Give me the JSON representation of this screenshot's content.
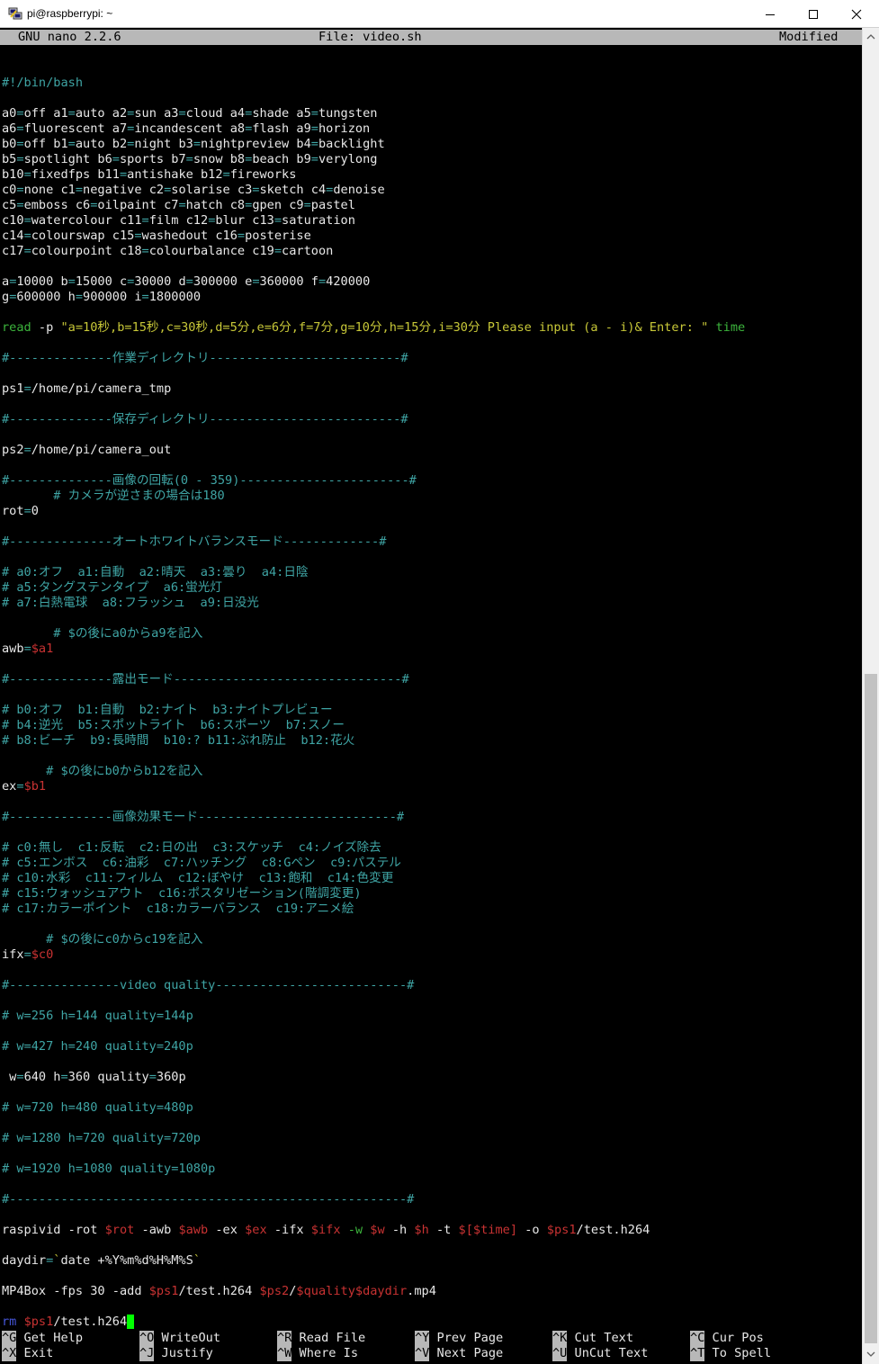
{
  "window": {
    "title": "pi@raspberrypi: ~",
    "minimize_icon": "minimize-icon",
    "maximize_icon": "maximize-icon",
    "close_icon": "close-icon"
  },
  "nano": {
    "version": "GNU nano 2.2.6",
    "file": "File: video.sh",
    "status": "Modified"
  },
  "lines": [
    [],
    [
      [
        "c",
        "#!/bin/bash"
      ]
    ],
    [],
    [
      [
        "t",
        "a0"
      ],
      [
        "c",
        "="
      ],
      [
        "t",
        "off a1"
      ],
      [
        "c",
        "="
      ],
      [
        "t",
        "auto a2"
      ],
      [
        "c",
        "="
      ],
      [
        "t",
        "sun a3"
      ],
      [
        "c",
        "="
      ],
      [
        "t",
        "cloud a4"
      ],
      [
        "c",
        "="
      ],
      [
        "t",
        "shade a5"
      ],
      [
        "c",
        "="
      ],
      [
        "t",
        "tungsten"
      ]
    ],
    [
      [
        "t",
        "a6"
      ],
      [
        "c",
        "="
      ],
      [
        "t",
        "fluorescent a7"
      ],
      [
        "c",
        "="
      ],
      [
        "t",
        "incandescent a8"
      ],
      [
        "c",
        "="
      ],
      [
        "t",
        "flash a9"
      ],
      [
        "c",
        "="
      ],
      [
        "t",
        "horizon"
      ]
    ],
    [
      [
        "t",
        "b0"
      ],
      [
        "c",
        "="
      ],
      [
        "t",
        "off b1"
      ],
      [
        "c",
        "="
      ],
      [
        "t",
        "auto b2"
      ],
      [
        "c",
        "="
      ],
      [
        "t",
        "night b3"
      ],
      [
        "c",
        "="
      ],
      [
        "t",
        "nightpreview b4"
      ],
      [
        "c",
        "="
      ],
      [
        "t",
        "backlight"
      ]
    ],
    [
      [
        "t",
        "b5"
      ],
      [
        "c",
        "="
      ],
      [
        "t",
        "spotlight b6"
      ],
      [
        "c",
        "="
      ],
      [
        "t",
        "sports b7"
      ],
      [
        "c",
        "="
      ],
      [
        "t",
        "snow b8"
      ],
      [
        "c",
        "="
      ],
      [
        "t",
        "beach b9"
      ],
      [
        "c",
        "="
      ],
      [
        "t",
        "verylong"
      ]
    ],
    [
      [
        "t",
        "b10"
      ],
      [
        "c",
        "="
      ],
      [
        "t",
        "fixedfps b11"
      ],
      [
        "c",
        "="
      ],
      [
        "t",
        "antishake b12"
      ],
      [
        "c",
        "="
      ],
      [
        "t",
        "fireworks"
      ]
    ],
    [
      [
        "t",
        "c0"
      ],
      [
        "c",
        "="
      ],
      [
        "t",
        "none c1"
      ],
      [
        "c",
        "="
      ],
      [
        "t",
        "negative c2"
      ],
      [
        "c",
        "="
      ],
      [
        "t",
        "solarise c3"
      ],
      [
        "c",
        "="
      ],
      [
        "t",
        "sketch c4"
      ],
      [
        "c",
        "="
      ],
      [
        "t",
        "denoise"
      ]
    ],
    [
      [
        "t",
        "c5"
      ],
      [
        "c",
        "="
      ],
      [
        "t",
        "emboss c6"
      ],
      [
        "c",
        "="
      ],
      [
        "t",
        "oilpaint c7"
      ],
      [
        "c",
        "="
      ],
      [
        "t",
        "hatch c8"
      ],
      [
        "c",
        "="
      ],
      [
        "t",
        "gpen c9"
      ],
      [
        "c",
        "="
      ],
      [
        "t",
        "pastel"
      ]
    ],
    [
      [
        "t",
        "c10"
      ],
      [
        "c",
        "="
      ],
      [
        "t",
        "watercolour c11"
      ],
      [
        "c",
        "="
      ],
      [
        "t",
        "film c12"
      ],
      [
        "c",
        "="
      ],
      [
        "t",
        "blur c13"
      ],
      [
        "c",
        "="
      ],
      [
        "t",
        "saturation"
      ]
    ],
    [
      [
        "t",
        "c14"
      ],
      [
        "c",
        "="
      ],
      [
        "t",
        "colourswap c15"
      ],
      [
        "c",
        "="
      ],
      [
        "t",
        "washedout c16"
      ],
      [
        "c",
        "="
      ],
      [
        "t",
        "posterise"
      ]
    ],
    [
      [
        "t",
        "c17"
      ],
      [
        "c",
        "="
      ],
      [
        "t",
        "colourpoint c18"
      ],
      [
        "c",
        "="
      ],
      [
        "t",
        "colourbalance c19"
      ],
      [
        "c",
        "="
      ],
      [
        "t",
        "cartoon"
      ]
    ],
    [],
    [
      [
        "t",
        "a"
      ],
      [
        "c",
        "="
      ],
      [
        "t",
        "10000 b"
      ],
      [
        "c",
        "="
      ],
      [
        "t",
        "15000 c"
      ],
      [
        "c",
        "="
      ],
      [
        "t",
        "30000 d"
      ],
      [
        "c",
        "="
      ],
      [
        "t",
        "300000 e"
      ],
      [
        "c",
        "="
      ],
      [
        "t",
        "360000 f"
      ],
      [
        "c",
        "="
      ],
      [
        "t",
        "420000"
      ]
    ],
    [
      [
        "t",
        "g"
      ],
      [
        "c",
        "="
      ],
      [
        "t",
        "600000 h"
      ],
      [
        "c",
        "="
      ],
      [
        "t",
        "900000 i"
      ],
      [
        "c",
        "="
      ],
      [
        "t",
        "1800000"
      ]
    ],
    [],
    [
      [
        "g",
        "read"
      ],
      [
        "t",
        " -p "
      ],
      [
        "s",
        "\"a=10秒,b=15秒,c=30秒,d=5分,e=6分,f=7分,g=10分,h=15分,i=30分 Please input (a - i)& Enter: \""
      ],
      [
        "t",
        " "
      ],
      [
        "g",
        "time"
      ]
    ],
    [],
    [
      [
        "c",
        "#--------------作業ディレクトリ--------------------------#"
      ]
    ],
    [],
    [
      [
        "t",
        "ps1"
      ],
      [
        "c",
        "="
      ],
      [
        "t",
        "/home/pi/camera_tmp"
      ]
    ],
    [],
    [
      [
        "c",
        "#--------------保存ディレクトリ--------------------------#"
      ]
    ],
    [],
    [
      [
        "t",
        "ps2"
      ],
      [
        "c",
        "="
      ],
      [
        "t",
        "/home/pi/camera_out"
      ]
    ],
    [],
    [
      [
        "c",
        "#--------------画像の回転(0 - 359)-----------------------#"
      ]
    ],
    [
      [
        "c",
        "       # カメラが逆さまの場合は180"
      ]
    ],
    [
      [
        "t",
        "rot"
      ],
      [
        "c",
        "="
      ],
      [
        "t",
        "0"
      ]
    ],
    [],
    [
      [
        "c",
        "#--------------オートホワイトバランスモード-------------#"
      ]
    ],
    [],
    [
      [
        "c",
        "# a0:オフ  a1:自動  a2:晴天  a3:曇り  a4:日陰"
      ]
    ],
    [
      [
        "c",
        "# a5:タングステンタイプ  a6:蛍光灯"
      ]
    ],
    [
      [
        "c",
        "# a7:白熱電球  a8:フラッシュ  a9:日没光"
      ]
    ],
    [],
    [
      [
        "c",
        "       # $の後にa0からa9を記入"
      ]
    ],
    [
      [
        "t",
        "awb"
      ],
      [
        "c",
        "="
      ],
      [
        "v",
        "$a1"
      ]
    ],
    [],
    [
      [
        "c",
        "#--------------露出モード-------------------------------#"
      ]
    ],
    [],
    [
      [
        "c",
        "# b0:オフ  b1:自動  b2:ナイト  b3:ナイトプレビュー"
      ]
    ],
    [
      [
        "c",
        "# b4:逆光  b5:スポットライト  b6:スポーツ  b7:スノー"
      ]
    ],
    [
      [
        "c",
        "# b8:ビーチ  b9:長時間  b10:? b11:ぶれ防止  b12:花火"
      ]
    ],
    [],
    [
      [
        "c",
        "      # $の後にb0からb12を記入"
      ]
    ],
    [
      [
        "t",
        "ex"
      ],
      [
        "c",
        "="
      ],
      [
        "v",
        "$b1"
      ]
    ],
    [],
    [
      [
        "c",
        "#--------------画像効果モード---------------------------#"
      ]
    ],
    [],
    [
      [
        "c",
        "# c0:無し  c1:反転  c2:日の出  c3:スケッチ  c4:ノイズ除去"
      ]
    ],
    [
      [
        "c",
        "# c5:エンボス  c6:油彩  c7:ハッチング  c8:Gペン  c9:パステル"
      ]
    ],
    [
      [
        "c",
        "# c10:水彩  c11:フィルム  c12:ぼやけ  c13:飽和  c14:色変更"
      ]
    ],
    [
      [
        "c",
        "# c15:ウォッシュアウト  c16:ポスタリゼーション(階調変更)"
      ]
    ],
    [
      [
        "c",
        "# c17:カラーポイント  c18:カラーバランス  c19:アニメ絵"
      ]
    ],
    [],
    [
      [
        "c",
        "      # $の後にc0からc19を記入"
      ]
    ],
    [
      [
        "t",
        "ifx"
      ],
      [
        "c",
        "="
      ],
      [
        "v",
        "$c0"
      ]
    ],
    [],
    [
      [
        "c",
        "#---------------video quality--------------------------#"
      ]
    ],
    [],
    [
      [
        "c",
        "# w=256 h=144 quality=144p"
      ]
    ],
    [],
    [
      [
        "c",
        "# w=427 h=240 quality=240p"
      ]
    ],
    [],
    [
      [
        "t",
        " w"
      ],
      [
        "c",
        "="
      ],
      [
        "t",
        "640 h"
      ],
      [
        "c",
        "="
      ],
      [
        "t",
        "360 quality"
      ],
      [
        "c",
        "="
      ],
      [
        "t",
        "360p"
      ]
    ],
    [],
    [
      [
        "c",
        "# w=720 h=480 quality=480p"
      ]
    ],
    [],
    [
      [
        "c",
        "# w=1280 h=720 quality=720p"
      ]
    ],
    [],
    [
      [
        "c",
        "# w=1920 h=1080 quality=1080p"
      ]
    ],
    [],
    [
      [
        "c",
        "#------------------------------------------------------#"
      ]
    ],
    [],
    [
      [
        "t",
        "raspivid -rot "
      ],
      [
        "v",
        "$rot"
      ],
      [
        "t",
        " -awb "
      ],
      [
        "v",
        "$awb"
      ],
      [
        "t",
        " -ex "
      ],
      [
        "v",
        "$ex"
      ],
      [
        "t",
        " -ifx "
      ],
      [
        "v",
        "$ifx"
      ],
      [
        "t",
        " "
      ],
      [
        "g",
        "-w"
      ],
      [
        "t",
        " "
      ],
      [
        "v",
        "$w"
      ],
      [
        "t",
        " -h "
      ],
      [
        "v",
        "$h"
      ],
      [
        "t",
        " -t "
      ],
      [
        "v",
        "$[$time]"
      ],
      [
        "t",
        " -o "
      ],
      [
        "v",
        "$ps1"
      ],
      [
        "t",
        "/test.h264"
      ]
    ],
    [],
    [
      [
        "t",
        "daydir"
      ],
      [
        "c",
        "="
      ],
      [
        "s",
        "`"
      ],
      [
        "t",
        "date +%Y%m%d%H%M%S"
      ],
      [
        "s",
        "`"
      ]
    ],
    [],
    [
      [
        "t",
        "MP4Box -fps 30 -add "
      ],
      [
        "v",
        "$ps1"
      ],
      [
        "t",
        "/test.h264 "
      ],
      [
        "v",
        "$ps2"
      ],
      [
        "t",
        "/"
      ],
      [
        "v",
        "$quality$daydir"
      ],
      [
        "t",
        ".mp4"
      ]
    ],
    [],
    [
      [
        "b",
        "rm"
      ],
      [
        "t",
        " "
      ],
      [
        "v",
        "$ps1"
      ],
      [
        "t",
        "/test.h264"
      ]
    ]
  ],
  "shortcuts": [
    {
      "key": "^G",
      "label": "Get Help"
    },
    {
      "key": "^O",
      "label": "WriteOut"
    },
    {
      "key": "^R",
      "label": "Read File"
    },
    {
      "key": "^Y",
      "label": "Prev Page"
    },
    {
      "key": "^K",
      "label": "Cut Text"
    },
    {
      "key": "^C",
      "label": "Cur Pos"
    },
    {
      "key": "^X",
      "label": "Exit"
    },
    {
      "key": "^J",
      "label": "Justify"
    },
    {
      "key": "^W",
      "label": "Where Is"
    },
    {
      "key": "^V",
      "label": "Next Page"
    },
    {
      "key": "^U",
      "label": "UnCut Text"
    },
    {
      "key": "^T",
      "label": "To Spell"
    }
  ],
  "colors": {
    "comment": "#3fa5a5",
    "variable": "#c83232",
    "keyword": "#3cb43c",
    "string": "#c8c838",
    "command": "#4656dc",
    "cursor": "#00ff00",
    "header_bg": "#b8b8b8"
  }
}
